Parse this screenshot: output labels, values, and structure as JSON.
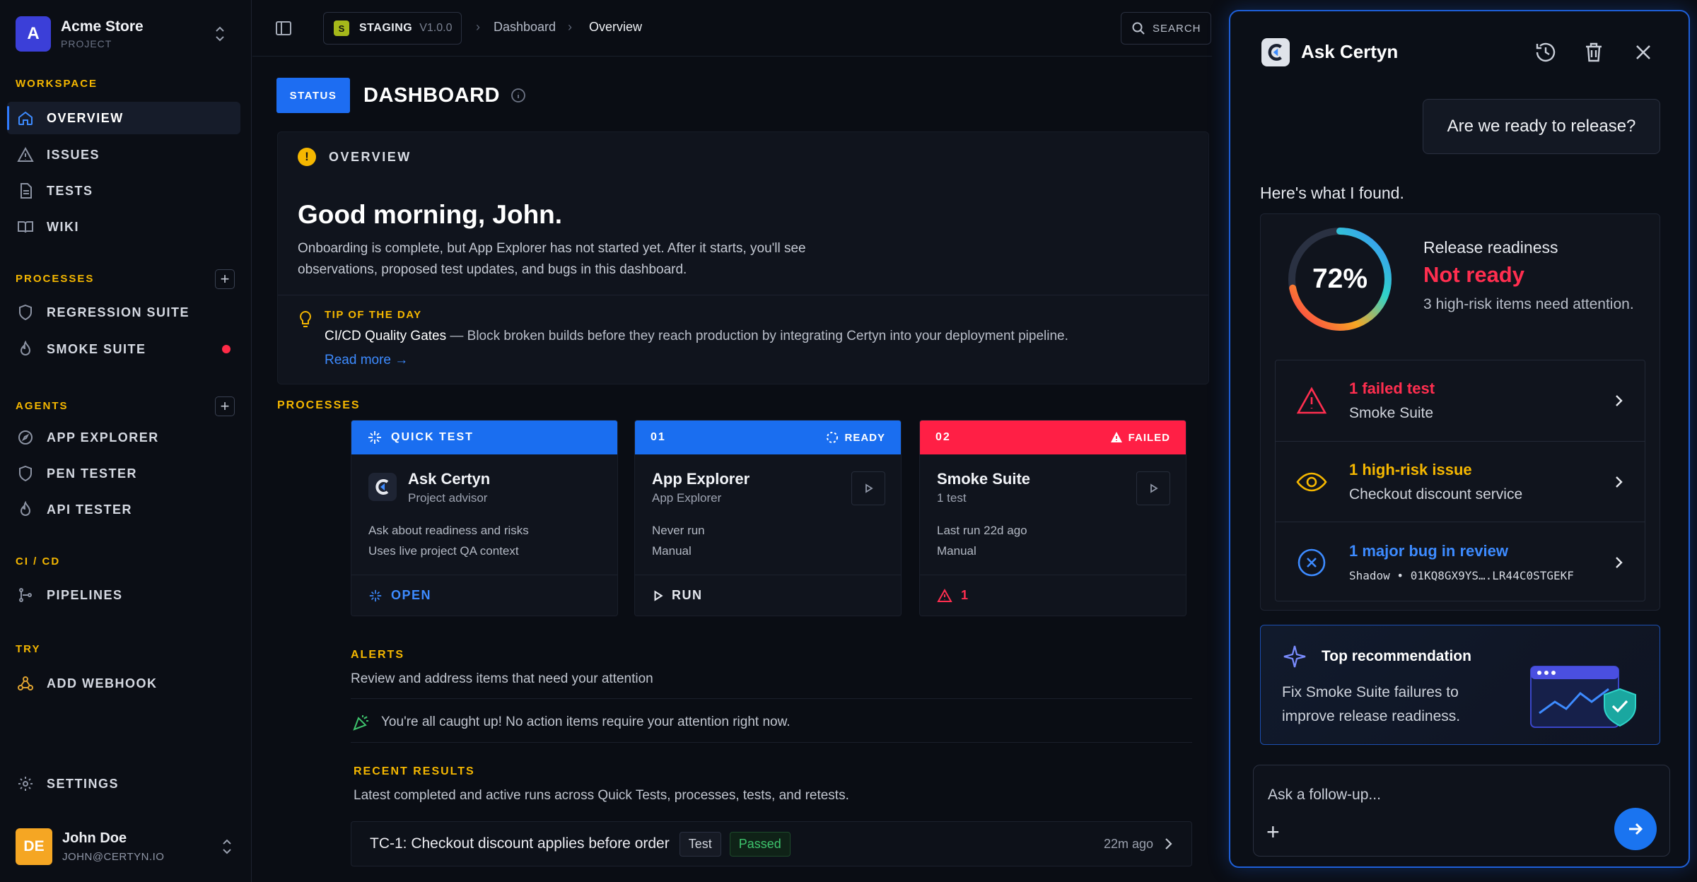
{
  "project": {
    "avatar": "A",
    "name": "Acme Store",
    "subtitle": "PROJECT"
  },
  "sidebar": {
    "workspace_label": "WORKSPACE",
    "workspace_items": [
      {
        "label": "OVERVIEW",
        "icon": "home-icon",
        "active": true
      },
      {
        "label": "ISSUES",
        "icon": "warning-icon"
      },
      {
        "label": "TESTS",
        "icon": "document-icon"
      },
      {
        "label": "WIKI",
        "icon": "book-icon"
      }
    ],
    "processes_label": "PROCESSES",
    "process_items": [
      {
        "label": "REGRESSION SUITE",
        "icon": "shield-icon"
      },
      {
        "label": "SMOKE SUITE",
        "icon": "flame-icon",
        "alert": true
      }
    ],
    "agents_label": "AGENTS",
    "agent_items": [
      {
        "label": "APP EXPLORER",
        "icon": "compass-icon"
      },
      {
        "label": "PEN TESTER",
        "icon": "shield-icon"
      },
      {
        "label": "API TESTER",
        "icon": "flame-icon"
      }
    ],
    "cicd_label": "CI / CD",
    "cicd_items": [
      {
        "label": "PIPELINES",
        "icon": "pipeline-icon"
      }
    ],
    "try_label": "TRY",
    "try_items": [
      {
        "label": "ADD WEBHOOK",
        "icon": "webhook-icon"
      }
    ],
    "settings_label": "SETTINGS"
  },
  "user": {
    "initials": "DE",
    "name": "John Doe",
    "email": "JOHN@CERTYN.IO"
  },
  "topbar": {
    "env_badge": "S",
    "env_name": "STAGING",
    "env_version": "V1.0.0",
    "breadcrumb": [
      "Dashboard",
      "Overview"
    ],
    "search_label": "SEARCH"
  },
  "dashboard": {
    "status_label": "STATUS",
    "title": "DASHBOARD"
  },
  "overview": {
    "label": "OVERVIEW",
    "greeting": "Good morning, John.",
    "description": "Onboarding is complete, but App Explorer has not started yet. After it starts, you'll see observations, proposed test updates, and bugs in this dashboard.",
    "tip_label": "TIP OF THE DAY",
    "tip_title": "CI/CD Quality Gates",
    "tip_body": " — Block broken builds before they reach production by integrating Certyn into your deployment pipeline.",
    "read_more": "Read more →"
  },
  "processes": {
    "label": "PROCESSES",
    "cards": [
      {
        "head_left": "QUICK TEST",
        "head_right": "",
        "head_color": "#1a6ef0",
        "title": "Ask Certyn",
        "subtitle": "Project advisor",
        "line1": "Ask about readiness and risks",
        "line2": "Uses live project QA context",
        "footer": "OPEN",
        "footer_color": "#3d8bff"
      },
      {
        "head_left": "01",
        "head_right": "READY",
        "head_color": "#1a6ef0",
        "title": "App Explorer",
        "subtitle": "App Explorer",
        "line1": "Never run",
        "line2": "Manual",
        "footer": "RUN",
        "footer_color": "#e6e9ef"
      },
      {
        "head_left": "02",
        "head_right": "FAILED",
        "head_color": "#ff1f45",
        "title": "Smoke Suite",
        "subtitle": "1 test",
        "line1": "Last run 22d ago",
        "line2": "Manual",
        "footer": "1",
        "footer_color": "#ff2e4f"
      }
    ]
  },
  "alerts": {
    "label": "ALERTS",
    "description": "Review and address items that need your attention",
    "empty": "You're all caught up! No action items require your attention right now."
  },
  "recent": {
    "label": "RECENT RESULTS",
    "description": "Latest completed and active runs across Quick Tests, processes, tests, and retests.",
    "rows": [
      {
        "title": "TC-1: Checkout discount applies before order",
        "tag": "Test",
        "status": "Passed",
        "time": "22m ago"
      }
    ]
  },
  "assistant": {
    "title": "Ask Certyn",
    "user_message": "Are we ready to release?",
    "reply_intro": "Here's what I found.",
    "readiness": {
      "percent": 72,
      "percent_label": "72%",
      "label": "Release readiness",
      "state": "Not ready",
      "note": "3 high-risk items need attention."
    },
    "issues": [
      {
        "title": "1 failed test",
        "subtitle": "Smoke Suite",
        "color": "#ff2e4f",
        "icon": "warning-triangle-icon"
      },
      {
        "title": "1 high-risk issue",
        "subtitle": "Checkout discount service",
        "color": "#f5b700",
        "icon": "eye-icon"
      },
      {
        "title": "1 major bug in review",
        "subtitle": "Shadow  •  01KQ8GX9YS….LR44C0STGEKF",
        "color": "#3d8bff",
        "icon": "x-circle-icon"
      }
    ],
    "recommendation": {
      "title": "Top recommendation",
      "body": "Fix Smoke Suite failures to improve release readiness."
    },
    "followup_placeholder": "Ask a follow-up..."
  },
  "colors": {
    "accent": "#1d6df2",
    "warning": "#f5b700",
    "danger": "#ff2e4f",
    "success": "#3ec46d"
  }
}
